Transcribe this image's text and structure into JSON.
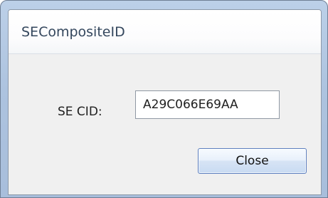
{
  "window": {
    "title": "SECompositeID"
  },
  "form": {
    "cid_label": "SE CID:",
    "cid_value": "A29C066E69AA"
  },
  "actions": {
    "close_label": "Close"
  }
}
